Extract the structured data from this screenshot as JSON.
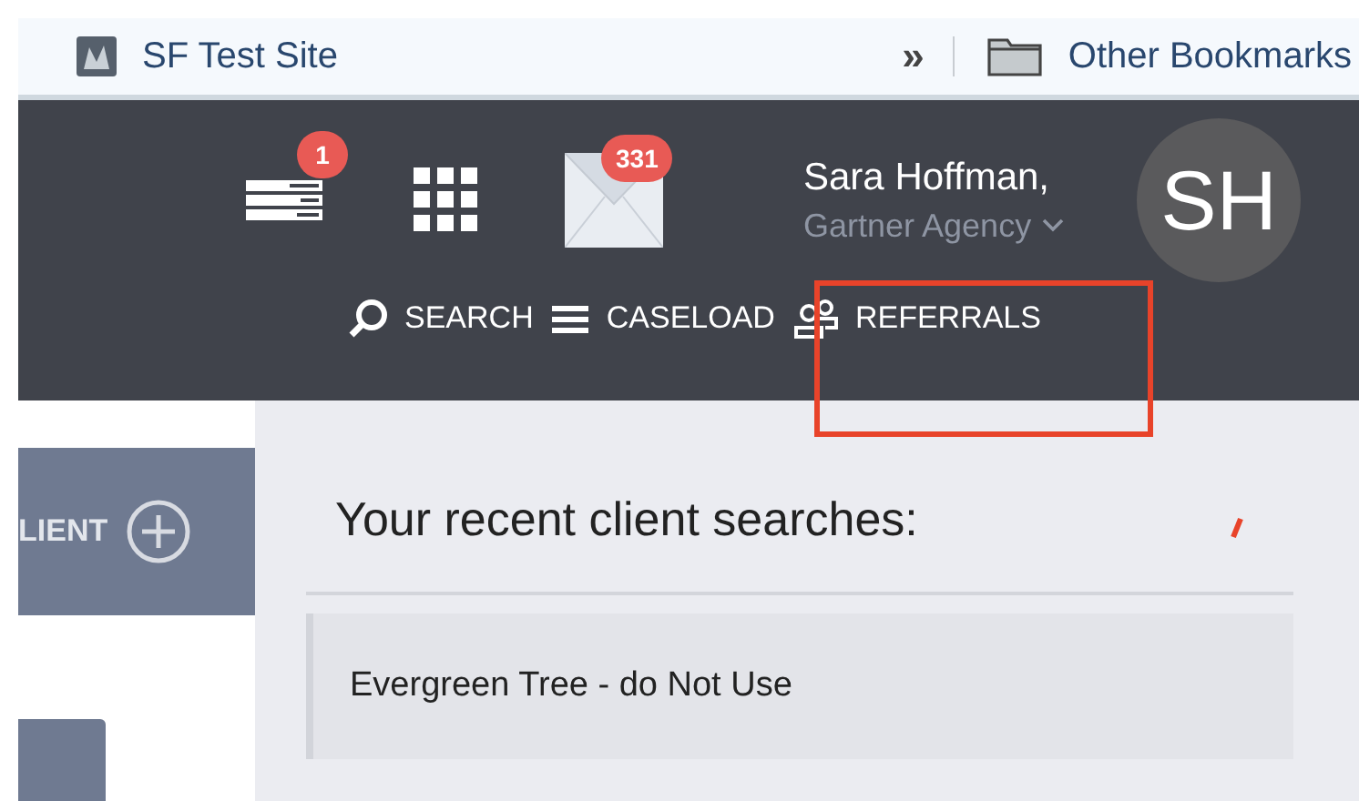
{
  "bookmarks_bar": {
    "items": [
      {
        "label": "SF Test Site"
      }
    ],
    "overflow": "»",
    "other": "Other Bookmarks"
  },
  "header": {
    "notifications_badge": "1",
    "messages_badge": "331",
    "user": {
      "name": "Sara Hoffman,",
      "agency": "Gartner Agency",
      "initials": "SH"
    },
    "nav": [
      {
        "label": "SEARCH",
        "kind": "search",
        "highlighted": false
      },
      {
        "label": "CASELOAD",
        "kind": "caseload",
        "highlighted": false
      },
      {
        "label": "REFERRALS",
        "kind": "referrals",
        "highlighted": true
      }
    ]
  },
  "sidebar": {
    "add_client_label": "LIENT"
  },
  "recent_searches": {
    "title": "Your recent client searches:",
    "items": [
      "Evergreen Tree - do Not Use"
    ]
  }
}
